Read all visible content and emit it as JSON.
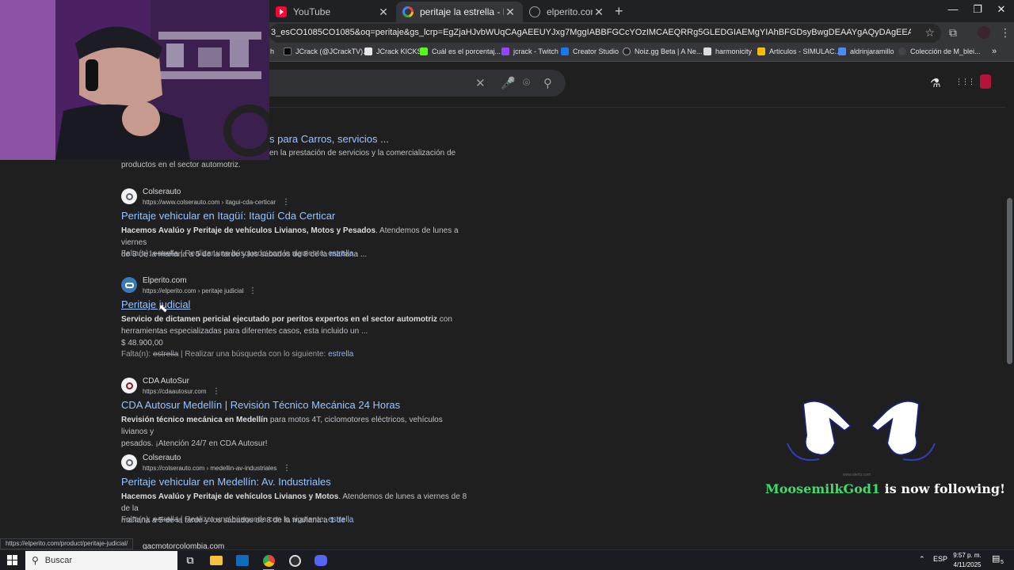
{
  "window": {
    "tabs": [
      {
        "label": "YouTube",
        "icon": "youtube-icon"
      },
      {
        "label": "peritaje la estrella - Buscar con",
        "icon": "google-icon",
        "active": true
      },
      {
        "label": "elperito.com/prod",
        "icon": "globe-icon"
      }
    ],
    "new_tab": "+",
    "controls": {
      "minimize": "—",
      "restore": "❐",
      "close": "✕"
    }
  },
  "address_bar": {
    "url": "3_esCO1085CO1085&oq=peritaje&gs_lcrp=EgZjaHJvbWUqCAgAEEUYJxg7MggIABBFGCcYOzIMCAEQRRg5GLEDGIAEMgYIAhBFGDsyBwgDEAAYgAQyDAgEEAAYFBiHAhiABDIGCAUQRRg8MgYIBhBFG...",
    "star": "☆",
    "extensions": "⧉",
    "menu": "⋮"
  },
  "bookmarks": [
    {
      "label": "h"
    },
    {
      "label": "JCrack (@JCrackTV)..."
    },
    {
      "label": "JCrack KICKS"
    },
    {
      "label": "Cuál es el porcentaj..."
    },
    {
      "label": "jcrack - Twitch"
    },
    {
      "label": "Creator Studio"
    },
    {
      "label": "Noiz.gg Beta | A Ne..."
    },
    {
      "label": "harmonicity"
    },
    {
      "label": "Articulos - SIMULAC..."
    },
    {
      "label": "aldrinjaramillo"
    },
    {
      "label": "Colección de M_blei..."
    },
    {
      "label": "»"
    }
  ],
  "search_header": {
    "clear": "✕",
    "voice": "🎤",
    "lens": "⌾",
    "search": "⚲",
    "labs": "⚗",
    "apps": "⋮⋮⋮"
  },
  "results": [
    {
      "partial": true,
      "title": "s para Carros, servicios ...",
      "snippet_line1": "en la prestación de servicios y la comercialización de",
      "snippet_line2": "productos en el sector automotriz."
    },
    {
      "site": "Colserauto",
      "url": "https://www.colserauto.com › itagui-cda-certicar",
      "title": "Peritaje vehicular en Itagüí: Itagüí Cda Certicar",
      "snippet_bold": "Hacemos Avalúo y Peritaje de vehículos Livianos, Motos y Pesados",
      "snippet_rest": ". Atendemos de lunes a viernes",
      "snippet_line2": "de 8 de la mañana a 5 de la tarde y los sábados de 8 de la mañana ...",
      "missing_label": "Falta(n):",
      "missing_word": "estrella",
      "missing_mid": "| Realizar una búsqueda con lo siguiente:",
      "missing_link": "estrella"
    },
    {
      "site": "Elperito.com",
      "url": "https://elperito.com › peritaje judicial",
      "title": "Peritaje judicial",
      "snippet_bold": "Servicio de dictamen pericial ejecutado por peritos expertos en el sector automotriz",
      "snippet_rest": " con",
      "snippet_line2": "herramientas especializadas para diferentes casos, esta incluido un ...",
      "price": "$ 48.900,00",
      "missing_label": "Falta(n):",
      "missing_word": "estrella",
      "missing_mid": "| Realizar una búsqueda con lo siguiente:",
      "missing_link": "estrella"
    },
    {
      "site": "CDA AutoSur",
      "url": "https://cdaautosur.com",
      "title": "CDA Autosur Medellín | Revisión Técnico Mecánica 24 Horas",
      "snippet_bold": "Revisión técnico mecánica en Medellín",
      "snippet_rest": " para motos 4T, ciclomotores eléctricos, vehículos livianos y",
      "snippet_line2": "pesados. ¡Atención 24/7 en CDA Autosur!"
    },
    {
      "site": "Colserauto",
      "url": "https://colserauto.com › medellin-av-industriales",
      "title": "Peritaje vehicular en Medellín: Av. Industriales",
      "snippet_bold": "Hacemos Avalúo y Peritaje de vehículos Livianos y Motos",
      "snippet_rest": ". Atendemos de lunes a viernes de 8 de la",
      "snippet_line2": "mañana a 5 de la tarde y los sábados de 8 de la mañana a 1 de ...",
      "missing_label": "Falta(n):",
      "missing_word": "estrella",
      "missing_mid": "| Realizar una búsqueda con lo siguiente:",
      "missing_link": "estrella"
    },
    {
      "partial": true,
      "site": "gacmotorcolombia.com"
    }
  ],
  "status_url": "https://elperito.com/product/peritaje-judicial/",
  "overlay": {
    "follower_name": "MoosemilkGod1",
    "follower_text": "is now following!",
    "watermark": "www.alerts.com",
    "name_color": "#3ddc6c"
  },
  "taskbar": {
    "search_label": "Buscar",
    "language": "ESP",
    "time": "9:57 p. m.",
    "date": "4/11/2025",
    "notifications": "5"
  }
}
